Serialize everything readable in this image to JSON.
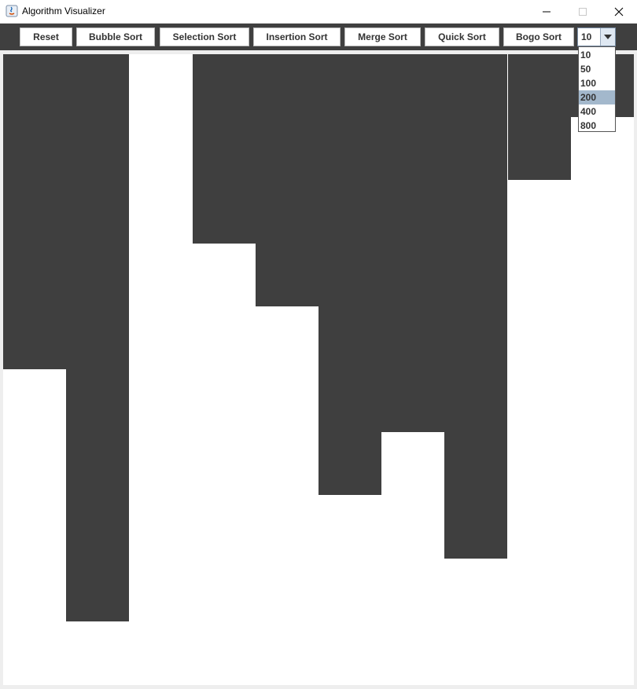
{
  "window": {
    "title": "Algorithm Visualizer",
    "minimize_glyph": "—",
    "maximize_glyph": "☐",
    "close_glyph": "✕"
  },
  "toolbar": {
    "buttons": [
      {
        "label": "Reset"
      },
      {
        "label": "Bubble Sort"
      },
      {
        "label": "Selection Sort"
      },
      {
        "label": "Insertion Sort"
      },
      {
        "label": "Merge Sort"
      },
      {
        "label": "Quick Sort"
      },
      {
        "label": "Bogo Sort"
      }
    ],
    "size_select": {
      "value": "10",
      "options": [
        "10",
        "50",
        "100",
        "200",
        "400",
        "800"
      ],
      "highlighted_option": "200"
    }
  },
  "visualizer": {
    "bar_color": "#3f3f3f",
    "background_color": "#ffffff",
    "max_value": 10,
    "bar_heights": [
      5,
      9,
      0,
      3,
      4,
      7,
      6,
      8,
      2,
      1
    ]
  },
  "colors": {
    "toolbar_bg": "#3f3f3f",
    "dropdown_highlight": "#a3b8cc"
  }
}
